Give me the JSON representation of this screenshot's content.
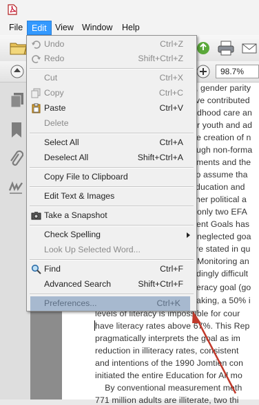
{
  "menubar": {
    "items": [
      "File",
      "Edit",
      "View",
      "Window",
      "Help"
    ]
  },
  "toolbar": {
    "zoom": "98.7%"
  },
  "edit_menu": {
    "undo": {
      "label": "Undo",
      "shortcut": "Ctrl+Z"
    },
    "redo": {
      "label": "Redo",
      "shortcut": "Shift+Ctrl+Z"
    },
    "cut": {
      "label": "Cut",
      "shortcut": "Ctrl+X"
    },
    "copy": {
      "label": "Copy",
      "shortcut": "Ctrl+C"
    },
    "paste": {
      "label": "Paste",
      "shortcut": "Ctrl+V"
    },
    "delete": {
      "label": "Delete"
    },
    "select_all": {
      "label": "Select All",
      "shortcut": "Ctrl+A"
    },
    "deselect_all": {
      "label": "Deselect All",
      "shortcut": "Shift+Ctrl+A"
    },
    "copy_clipboard": {
      "label": "Copy File to Clipboard"
    },
    "edit_text": {
      "label": "Edit Text & Images"
    },
    "snapshot": {
      "label": "Take a Snapshot"
    },
    "check_spelling": {
      "label": "Check Spelling"
    },
    "look_up": {
      "label": "Look Up Selected Word..."
    },
    "find": {
      "label": "Find",
      "shortcut": "Ctrl+F"
    },
    "advanced_search": {
      "label": "Advanced Search",
      "shortcut": "Shift+Ctrl+F"
    },
    "preferences": {
      "label": "Preferences...",
      "shortcut": "Ctrl+K"
    }
  },
  "document": {
    "lines": [
      ", gender parity",
      "ve contributed",
      "dhood care an",
      "r youth and ad",
      "e creation of n",
      "ugh non-forma",
      "ments and the",
      " to assume tha",
      "ducation and",
      "her political a",
      " only two EFA",
      "ent Goals has",
      "neglected goa",
      "re stated in qu",
      "Monitoring an",
      "dingly difficult",
      "eracy goal (go",
      "aking, a 50% i",
      "levels of literacy is impossible for cour",
      "have literacy rates above 67%. This Rep",
      "pragmatically interprets the goal as im",
      "reduction in illiteracy rates, consistent",
      "and intentions of the 1990 Jomtien con",
      "initiated the entire Education for All mo",
      "    By conventional measurement meth",
      "771 million adults are illiterate, two thi"
    ]
  }
}
